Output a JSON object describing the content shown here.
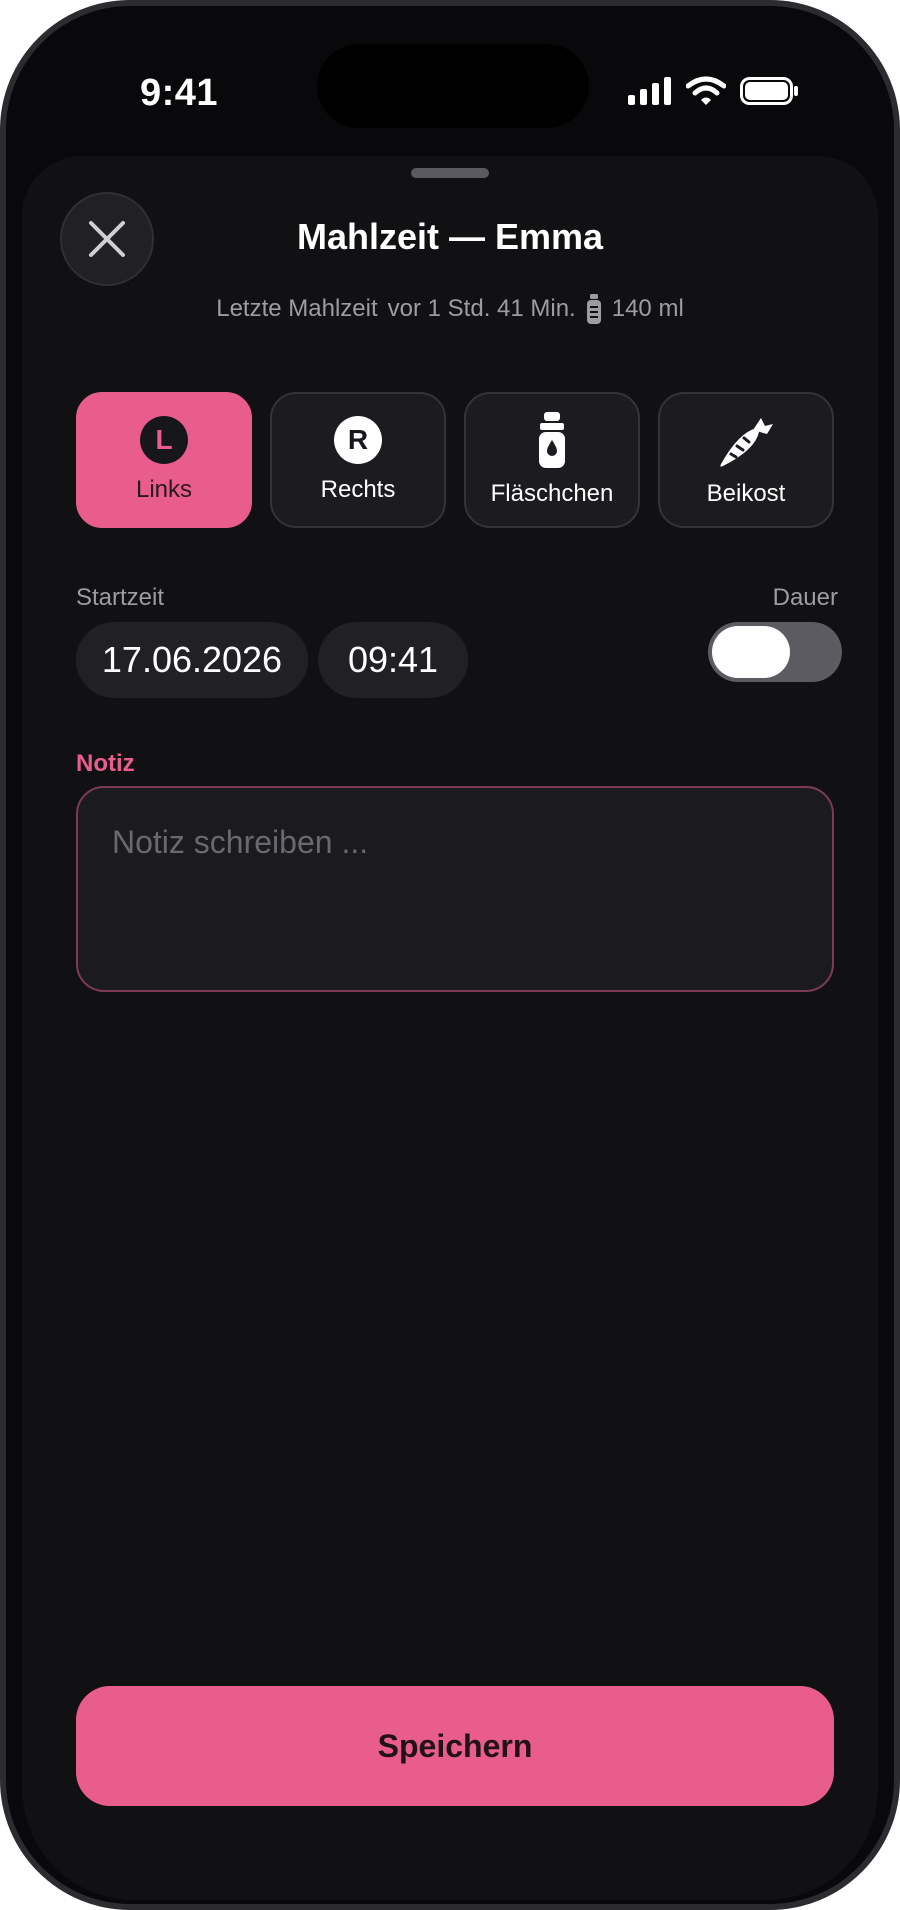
{
  "status_bar": {
    "time": "9:41"
  },
  "sheet": {
    "title": "Mahlzeit — Emma",
    "subtitle": {
      "label": "Letzte Mahlzeit",
      "ago": "vor 1 Std. 41 Min.",
      "amount": "140 ml",
      "icon": "bottle-icon"
    }
  },
  "options": [
    {
      "label": "Links",
      "badge": "L",
      "selected": true
    },
    {
      "label": "Rechts",
      "badge": "R",
      "selected": false
    },
    {
      "label": "Fläschchen",
      "icon": "bottle-icon",
      "selected": false
    },
    {
      "label": "Beikost",
      "icon": "carrot-icon",
      "selected": false
    }
  ],
  "start": {
    "label": "Startzeit",
    "date": "17.06.2026",
    "time": "09:41",
    "duration_label": "Dauer",
    "duration_enabled": false
  },
  "note": {
    "label": "Notiz",
    "placeholder": "Notiz schreiben ...",
    "value": ""
  },
  "save_label": "Speichern",
  "colors": {
    "accent": "#e85d8b",
    "background": "#09090b",
    "surface": "#1c1c20"
  }
}
